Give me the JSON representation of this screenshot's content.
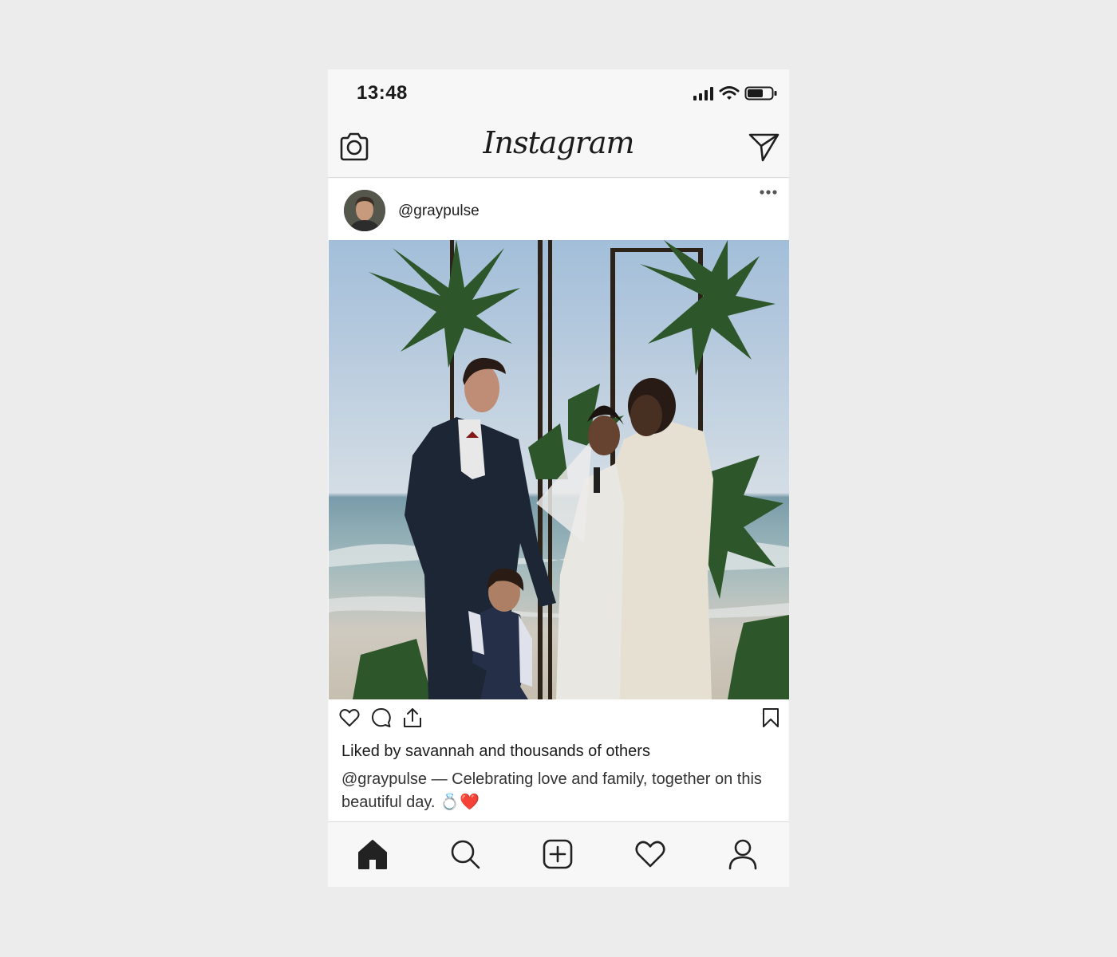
{
  "status_bar": {
    "time": "13:48",
    "icons": [
      "signal-icon",
      "wifi-icon",
      "battery-icon"
    ]
  },
  "app_header": {
    "logo_text": "Instagram",
    "left_icon": "camera-icon",
    "right_icon": "direct-message-icon"
  },
  "post": {
    "username": "@graypulse",
    "avatar": "avatar",
    "more_icon": "more-options-icon",
    "image_alt": "wedding-ceremony-photo",
    "actions": [
      "like-icon",
      "comment-icon",
      "share-icon",
      "bookmark-icon"
    ],
    "likes_text": "Liked by savannah and thousands of others",
    "caption_user": "@graypulse",
    "caption_text": " — Celebrating love and family, together on this beautiful day. 💍❤️"
  },
  "bottom_nav": {
    "items": [
      "home-icon",
      "search-icon",
      "new-post-icon",
      "activity-icon",
      "profile-icon"
    ]
  },
  "colors": {
    "background": "#ececec",
    "phone_bg": "#f7f7f7",
    "card_bg": "#ffffff",
    "text": "#1f1f1f"
  }
}
